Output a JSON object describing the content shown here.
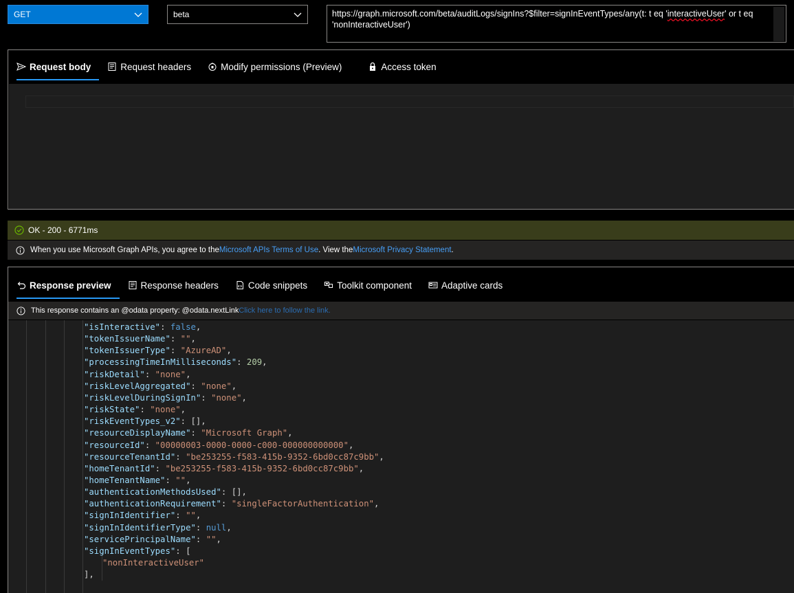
{
  "request": {
    "method": "GET",
    "version": "beta",
    "url_part1": "https://graph.microsoft.com/beta/auditLogs/signIns?$filter=signInEventTypes/any(t: t eq '",
    "url_squiggle": "interactiveUser",
    "url_part2": "' or t eq 'nonInteractiveUser')"
  },
  "request_tabs": [
    {
      "label": "Request body",
      "icon": "send-icon",
      "active": true
    },
    {
      "label": "Request headers",
      "icon": "headers-icon",
      "active": false
    },
    {
      "label": "Modify permissions (Preview)",
      "icon": "shield-icon",
      "active": false
    },
    {
      "label": "Access token",
      "icon": "lock-icon",
      "active": false
    }
  ],
  "status": {
    "text": "OK - 200 - 6771ms",
    "color": "#393d1b"
  },
  "notice": {
    "prefix": "When you use Microsoft Graph APIs, you agree to the ",
    "terms_link": "Microsoft APIs Terms of Use",
    "middle": ". View the ",
    "privacy_link": "Microsoft Privacy Statement",
    "suffix": "."
  },
  "response_tabs": [
    {
      "label": "Response preview",
      "icon": "undo-icon",
      "active": true
    },
    {
      "label": "Response headers",
      "icon": "headers-icon",
      "active": false
    },
    {
      "label": "Code snippets",
      "icon": "code-icon",
      "active": false
    },
    {
      "label": "Toolkit component",
      "icon": "toolkit-icon",
      "active": false
    },
    {
      "label": "Adaptive cards",
      "icon": "card-icon",
      "active": false
    }
  ],
  "odata": {
    "text": "This response contains an @odata property: @odata.nextLink ",
    "link": "Click here to follow the link."
  },
  "json_lines": [
    {
      "key": "\"isInteractive\"",
      "val": "false",
      "type": "kw",
      "end": ","
    },
    {
      "key": "\"tokenIssuerName\"",
      "val": "\"\"",
      "type": "s",
      "end": ","
    },
    {
      "key": "\"tokenIssuerType\"",
      "val": "\"AzureAD\"",
      "type": "s",
      "end": ","
    },
    {
      "key": "\"processingTimeInMilliseconds\"",
      "val": "209",
      "type": "n",
      "end": ","
    },
    {
      "key": "\"riskDetail\"",
      "val": "\"none\"",
      "type": "s",
      "end": ","
    },
    {
      "key": "\"riskLevelAggregated\"",
      "val": "\"none\"",
      "type": "s",
      "end": ","
    },
    {
      "key": "\"riskLevelDuringSignIn\"",
      "val": "\"none\"",
      "type": "s",
      "end": ","
    },
    {
      "key": "\"riskState\"",
      "val": "\"none\"",
      "type": "s",
      "end": ","
    },
    {
      "key": "\"riskEventTypes_v2\"",
      "val": "[]",
      "type": "p",
      "end": ","
    },
    {
      "key": "\"resourceDisplayName\"",
      "val": "\"Microsoft Graph\"",
      "type": "s",
      "end": ","
    },
    {
      "key": "\"resourceId\"",
      "val": "\"00000003-0000-0000-c000-000000000000\"",
      "type": "s",
      "end": ","
    },
    {
      "key": "\"resourceTenantId\"",
      "val": "\"be253255-f583-415b-9352-6bd0cc87c9bb\"",
      "type": "s",
      "end": ","
    },
    {
      "key": "\"homeTenantId\"",
      "val": "\"be253255-f583-415b-9352-6bd0cc87c9bb\"",
      "type": "s",
      "end": ","
    },
    {
      "key": "\"homeTenantName\"",
      "val": "\"\"",
      "type": "s",
      "end": ","
    },
    {
      "key": "\"authenticationMethodsUsed\"",
      "val": "[]",
      "type": "p",
      "end": ","
    },
    {
      "key": "\"authenticationRequirement\"",
      "val": "\"singleFactorAuthentication\"",
      "type": "s",
      "end": ","
    },
    {
      "key": "\"signInIdentifier\"",
      "val": "\"\"",
      "type": "s",
      "end": ","
    },
    {
      "key": "\"signInIdentifierType\"",
      "val": "null",
      "type": "kw",
      "end": ","
    },
    {
      "key": "\"servicePrincipalName\"",
      "val": "\"\"",
      "type": "s",
      "end": ","
    },
    {
      "key": "\"signInEventTypes\"",
      "val": "[",
      "type": "p",
      "end": ""
    }
  ],
  "json_array_item": "\"nonInteractiveUser\"",
  "json_array_close": "],"
}
